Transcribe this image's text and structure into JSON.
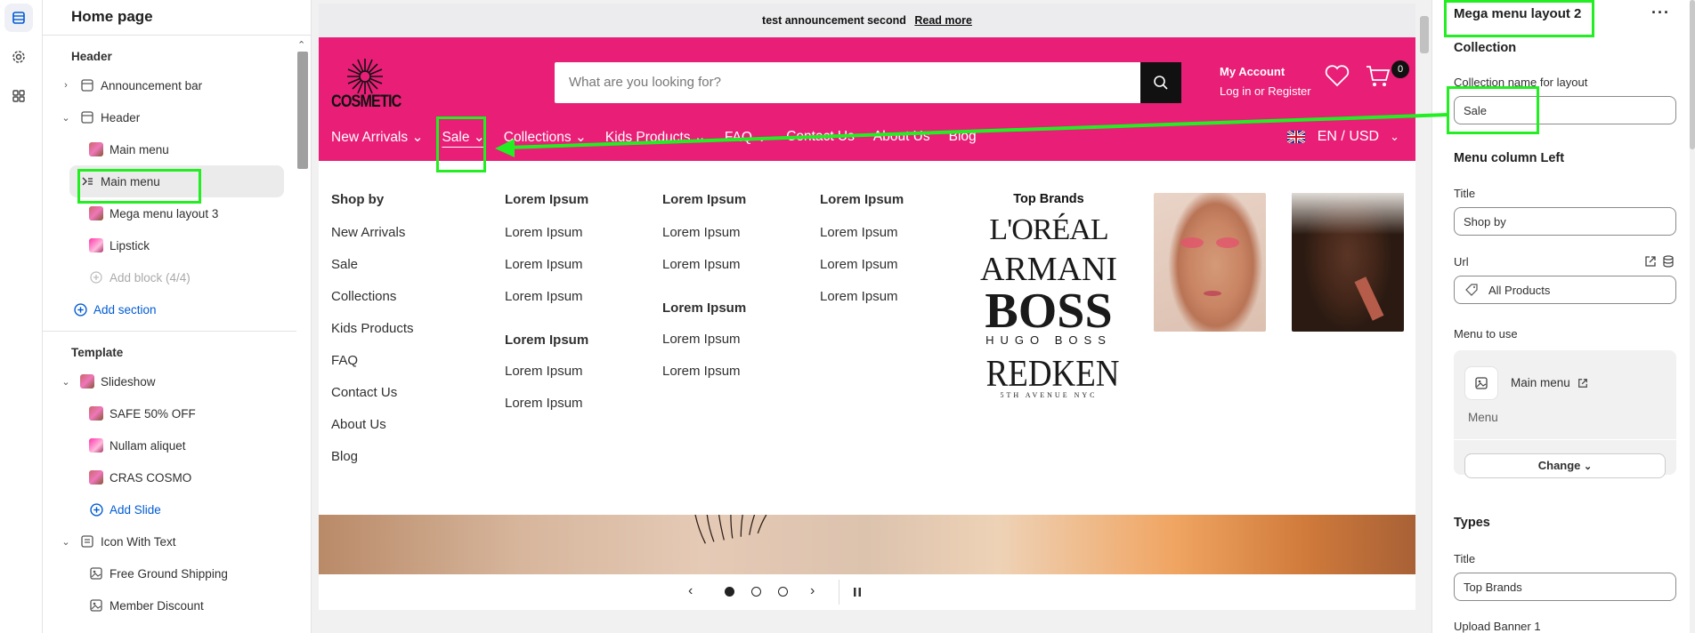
{
  "rail": {
    "icons": [
      "layout-icon",
      "settings-icon",
      "apps-icon"
    ]
  },
  "sidebar": {
    "title": "Home page",
    "header_group": "Header",
    "items": [
      {
        "label": "Announcement bar"
      },
      {
        "label": "Header"
      },
      {
        "label": "Main menu"
      },
      {
        "label": "Main menu"
      },
      {
        "label": "Mega menu layout 3"
      },
      {
        "label": "Lipstick"
      },
      {
        "label": "Add block (4/4)"
      },
      {
        "label": "Add section"
      }
    ],
    "template_group": "Template",
    "template_items": [
      {
        "label": "Slideshow"
      },
      {
        "label": "SAFE 50% OFF"
      },
      {
        "label": "Nullam aliquet"
      },
      {
        "label": "CRAS COSMO"
      },
      {
        "label": "Add Slide"
      },
      {
        "label": "Icon With Text"
      },
      {
        "label": "Free Ground Shipping"
      },
      {
        "label": "Member Discount"
      }
    ]
  },
  "preview": {
    "announcement": {
      "text": "test announcement second",
      "link": "Read more"
    },
    "logo_text": "COSMETIC",
    "search_placeholder": "What are you looking for?",
    "account": {
      "title": "My Account",
      "sub": "Log in or Register"
    },
    "cart_count": "0",
    "nav": [
      {
        "label": "New Arrivals",
        "chevron": "⌄"
      },
      {
        "label": "Sale",
        "chevron": "⌄"
      },
      {
        "label": "Collections",
        "chevron": "⌄"
      },
      {
        "label": "Kids Products",
        "chevron": "⌄"
      },
      {
        "label": "FAQ",
        "chevron": "⌄"
      },
      {
        "label": "Contact Us",
        "chevron": ""
      },
      {
        "label": "About Us",
        "chevron": ""
      },
      {
        "label": "Blog",
        "chevron": ""
      }
    ],
    "locale": "EN / USD",
    "mega": {
      "shop_by": {
        "heading": "Shop by",
        "items": [
          "New Arrivals",
          "Sale",
          "Collections",
          "Kids Products",
          "FAQ",
          "Contact Us",
          "About Us",
          "Blog"
        ]
      },
      "col2": {
        "heading": "Lorem Ipsum",
        "items": [
          "Lorem Ipsum",
          "Lorem Ipsum",
          "Lorem Ipsum"
        ],
        "heading2": "Lorem Ipsum",
        "items2": [
          "Lorem Ipsum",
          "Lorem Ipsum"
        ]
      },
      "col3": {
        "heading": "Lorem Ipsum",
        "items": [
          "Lorem Ipsum",
          "Lorem Ipsum"
        ],
        "heading2": "Lorem Ipsum",
        "items2": [
          "Lorem Ipsum",
          "Lorem Ipsum"
        ]
      },
      "col4": {
        "heading": "Lorem Ipsum",
        "items": [
          "Lorem Ipsum",
          "Lorem Ipsum",
          "Lorem Ipsum"
        ]
      },
      "brands": {
        "heading": "Top Brands",
        "loreal": "L'ORÉAL",
        "armani": "ARMANI",
        "boss": "BOSS",
        "boss_sub": "HUGO BOSS",
        "redken": "REDKEN",
        "redken_sub": "5TH AVENUE NYC"
      }
    }
  },
  "panel": {
    "title": "Mega menu layout 2",
    "section_collection": "Collection",
    "collection_label": "Collection name for layout",
    "collection_value": "Sale",
    "menu_left": "Menu column Left",
    "title_label": "Title",
    "title_value": "Shop by",
    "url_label": "Url",
    "url_value": "All Products",
    "menu_to_use": "Menu to use",
    "menu_name": "Main menu",
    "menu_type": "Menu",
    "change": "Change",
    "types": "Types",
    "title2_label": "Title",
    "title2_value": "Top Brands",
    "upload_banner": "Upload Banner 1"
  },
  "colors": {
    "brand_pink": "#e91e77",
    "highlight": "#22ee22",
    "link_blue": "#005bd3"
  }
}
